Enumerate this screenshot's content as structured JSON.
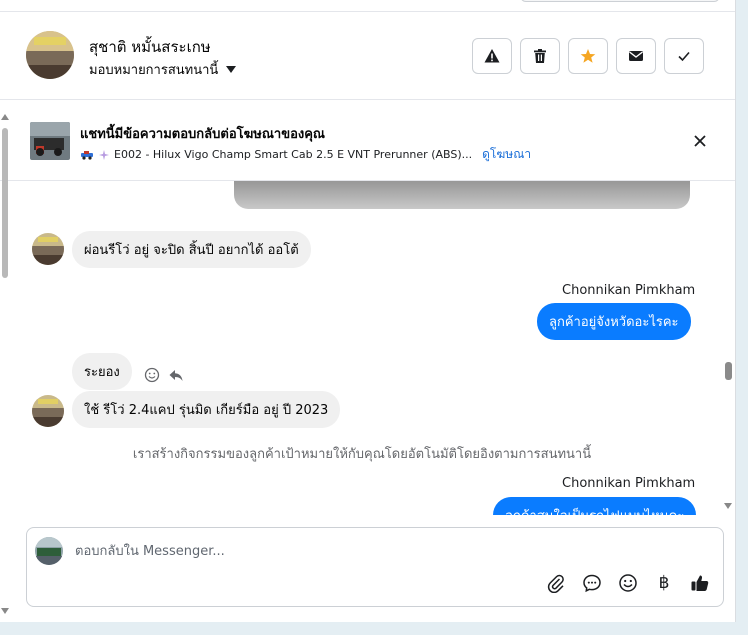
{
  "header": {
    "contact_name": "สุชาติ หมั้นสระเกษ",
    "assign_label": "มอบหมายการสนทนานี้"
  },
  "ad_banner": {
    "title": "แชทนี้มีข้อความตอบกลับต่อโฆษณาของคุณ",
    "subtitle": "E002 - Hilux Vigo Champ Smart Cab 2.5 E VNT Prerunner (ABS)...",
    "link": "ดูโฆษณา"
  },
  "messages": [
    {
      "direction": "in",
      "text": "ผ่อนรีโว่ อยู่ จะปิด สิ้นปี อยากได้ ออโต้"
    },
    {
      "direction": "out",
      "sender": "Chonnikan Pimkham",
      "text": "ลูกค้าอยู่จังหวัดอะไรคะ"
    },
    {
      "direction": "in",
      "text": "ระยอง"
    },
    {
      "direction": "in",
      "text": "ใช้ รีโว่ 2.4แคป รุ่นมิด เกียร์มือ อยู่ ปี 2023"
    },
    {
      "direction": "system",
      "text": "เราสร้างกิจกรรมของลูกค้าเป้าหมายให้กับคุณโดยอัตโนมัติโดยอิงตามการสนทนานี้"
    },
    {
      "direction": "out",
      "sender": "Chonnikan Pimkham",
      "text": "ลูกค้าสนใจเป็นรถไฟแบบไหนคะ"
    }
  ],
  "composer": {
    "placeholder": "ตอบกลับใน Messenger..."
  },
  "icons": {
    "currency_symbol": "฿"
  },
  "colors": {
    "accent": "#0a7cff",
    "star": "#f5a623",
    "link": "#1a6ed8"
  }
}
